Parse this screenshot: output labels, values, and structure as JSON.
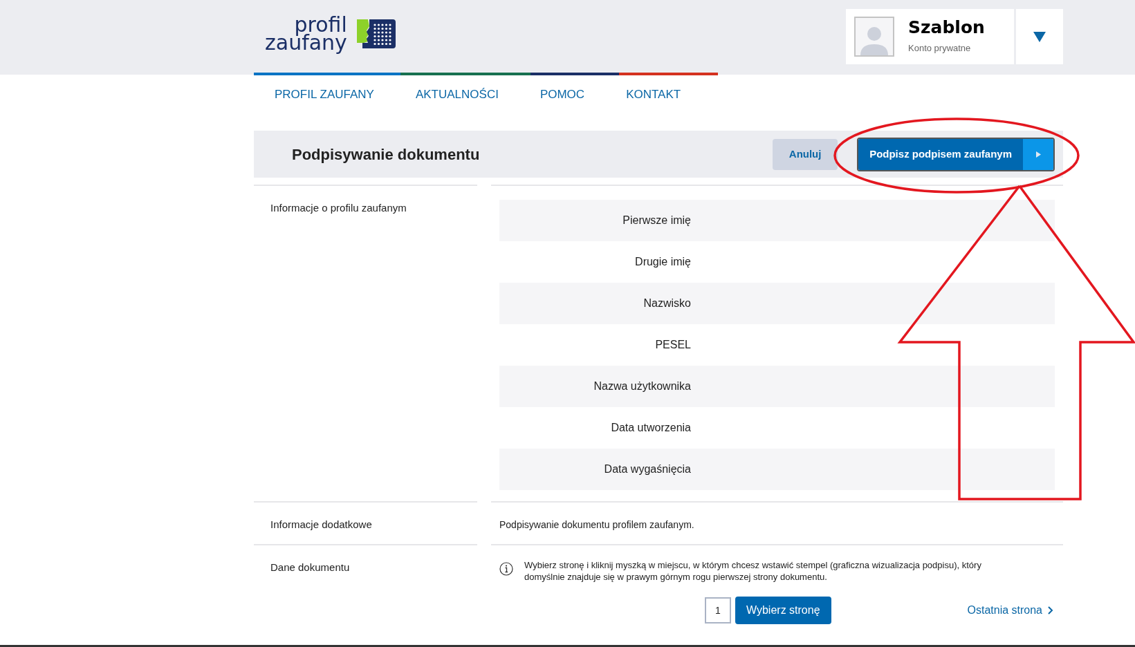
{
  "header": {
    "logo": {
      "line1": "profil",
      "line2": "zaufany"
    },
    "account": {
      "name": "Szablon",
      "type": "Konto prywatne"
    }
  },
  "nav": [
    {
      "label": "PROFIL ZAUFANY"
    },
    {
      "label": "AKTUALNOŚCI"
    },
    {
      "label": "POMOC"
    },
    {
      "label": "KONTAKT"
    }
  ],
  "title_bar": {
    "title": "Podpisywanie dokumentu",
    "cancel": "Anuluj",
    "sign": "Podpisz podpisem zaufanym"
  },
  "sections": [
    {
      "kind": "fields",
      "label": "Informacje o profilu zaufanym",
      "fields": [
        "Pierwsze imię",
        "Drugie imię",
        "Nazwisko",
        "PESEL",
        "Nazwa użytkownika",
        "Data utworzenia",
        "Data wygaśnięcia"
      ]
    },
    {
      "kind": "text",
      "label": "Informacje dodatkowe",
      "text": "Podpisywanie dokumentu profilem zaufanym."
    },
    {
      "kind": "info",
      "label": "Dane dokumentu",
      "text": "Wybierz stronę i kliknij myszką w miejscu, w którym chcesz wstawić stempel (graficzna wizualizacja podpisu), który domyślnie znajduje się w prawym górnym rogu pierwszej strony dokumentu."
    }
  ],
  "pager": {
    "page": "1",
    "choose": "Wybierz stronę",
    "last": "Ostatnia strona"
  }
}
